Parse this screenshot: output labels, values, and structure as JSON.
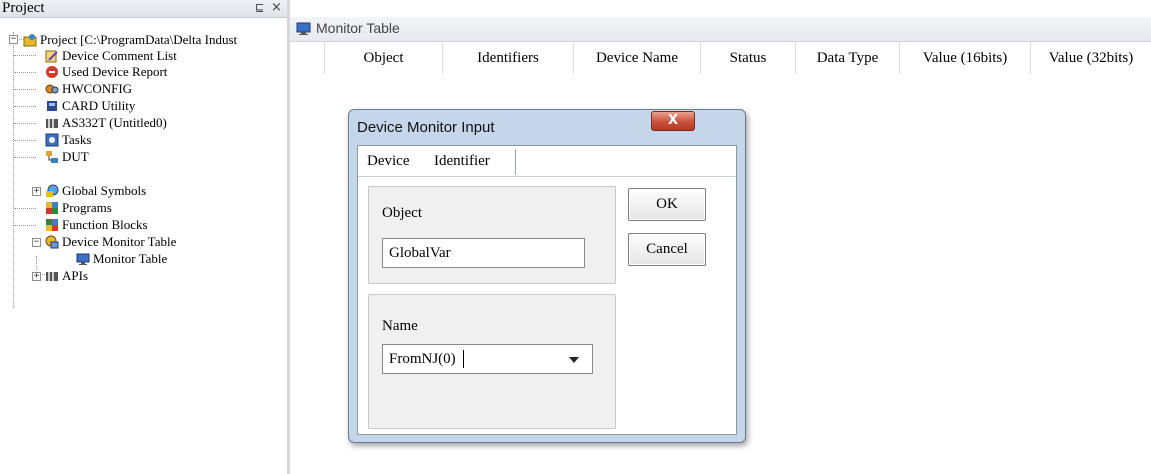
{
  "project_pane": {
    "title": "Project",
    "pin_glyph": "⊑",
    "close_glyph": "×",
    "tree": [
      {
        "label": "Project [C:\\ProgramData\\Delta Indust",
        "icon": "project-icon",
        "expander": "−"
      },
      {
        "label": "Device Comment List",
        "icon": "comment-list-icon"
      },
      {
        "label": "Used Device Report",
        "icon": "report-icon"
      },
      {
        "label": "HWCONFIG",
        "icon": "hwconfig-icon"
      },
      {
        "label": "CARD Utility",
        "icon": "card-icon"
      },
      {
        "label": "AS332T  (Untitled0)",
        "icon": "plc-icon"
      },
      {
        "label": "Tasks",
        "icon": "tasks-icon"
      },
      {
        "label": "DUT",
        "icon": "dut-icon"
      },
      {
        "label": "Global Symbols",
        "icon": "global-symbols-icon",
        "expander": "+"
      },
      {
        "label": "Programs",
        "icon": "programs-icon"
      },
      {
        "label": "Function Blocks",
        "icon": "function-blocks-icon"
      },
      {
        "label": "Device Monitor Table",
        "icon": "device-monitor-icon",
        "expander": "−"
      },
      {
        "label": "Monitor Table",
        "icon": "monitor-table-icon"
      },
      {
        "label": "APIs",
        "icon": "apis-icon",
        "expander": "+"
      }
    ]
  },
  "monitor": {
    "tab_label": "Monitor Table",
    "columns": [
      "Object",
      "Identifiers",
      "Device Name",
      "Status",
      "Data Type",
      "Value (16bits)",
      "Value (32bits)"
    ]
  },
  "dialog": {
    "title": "Device Monitor Input",
    "close_glyph": "X",
    "tabs": [
      "Device",
      "Identifier"
    ],
    "object_label": "Object",
    "object_value": "GlobalVar",
    "name_label": "Name",
    "name_value": "FromNJ(0)",
    "ok_label": "OK",
    "cancel_label": "Cancel"
  },
  "colors": {
    "dialog_frame": "#c6d6ea",
    "close_button": "#c9503a",
    "tab_bar": "#e6e9ee"
  }
}
